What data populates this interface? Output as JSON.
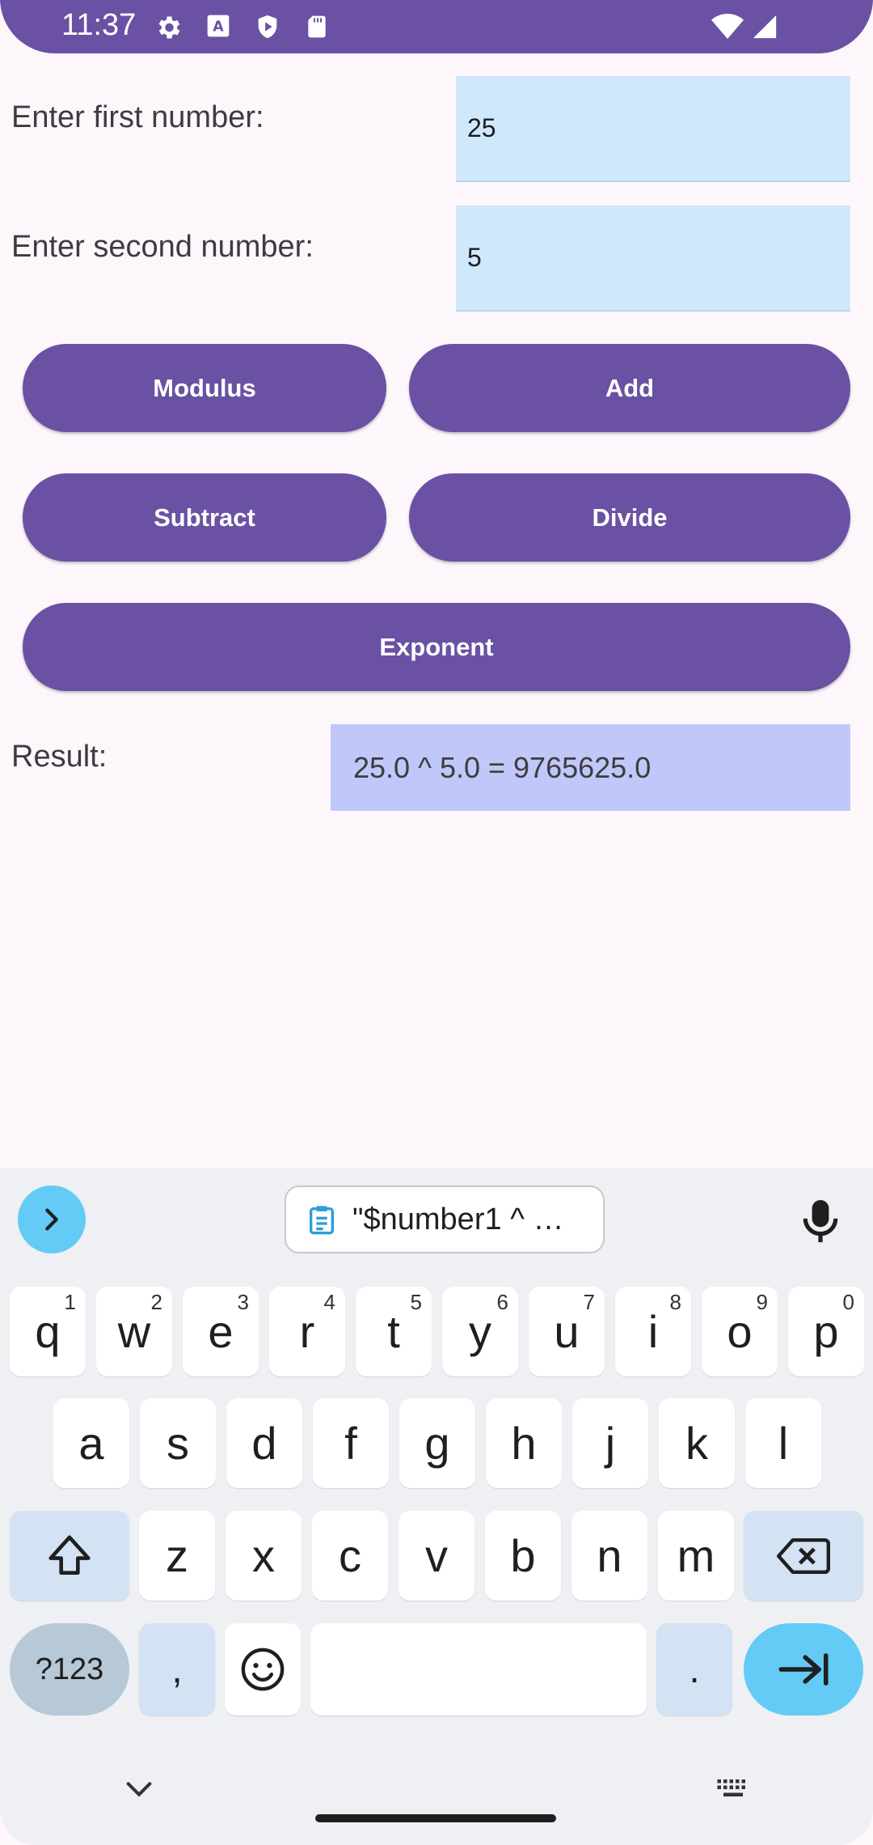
{
  "status_bar": {
    "time": "11:37",
    "icons": [
      "gear-icon",
      "font-icon",
      "shield-icon",
      "sd-card-icon",
      "wifi-icon",
      "signal-icon"
    ]
  },
  "form": {
    "first_label": "Enter first number:",
    "first_value": "25",
    "second_label": "Enter second number:",
    "second_value": "5"
  },
  "buttons": {
    "modulus": "Modulus",
    "add": "Add",
    "subtract": "Subtract",
    "divide": "Divide",
    "exponent": "Exponent"
  },
  "result": {
    "label": "Result:",
    "value": "25.0 ^ 5.0 = 9765625.0"
  },
  "keyboard": {
    "clipboard_suggestion": "\"$number1 ^ …",
    "row1": [
      {
        "key": "q",
        "hint": "1"
      },
      {
        "key": "w",
        "hint": "2"
      },
      {
        "key": "e",
        "hint": "3"
      },
      {
        "key": "r",
        "hint": "4"
      },
      {
        "key": "t",
        "hint": "5"
      },
      {
        "key": "y",
        "hint": "6"
      },
      {
        "key": "u",
        "hint": "7"
      },
      {
        "key": "i",
        "hint": "8"
      },
      {
        "key": "o",
        "hint": "9"
      },
      {
        "key": "p",
        "hint": "0"
      }
    ],
    "row2": [
      "a",
      "s",
      "d",
      "f",
      "g",
      "h",
      "j",
      "k",
      "l"
    ],
    "row3": [
      "z",
      "x",
      "c",
      "v",
      "b",
      "n",
      "m"
    ],
    "symbols_key": "?123",
    "comma_key": ",",
    "period_key": "."
  },
  "colors": {
    "primary": "#6a51a3",
    "field_bg": "#d0e8fb",
    "result_bg": "#bfc8f9",
    "page_bg": "#fdf7fc",
    "keyboard_bg": "#eff0f3",
    "accent_blue": "#63cbf5"
  }
}
